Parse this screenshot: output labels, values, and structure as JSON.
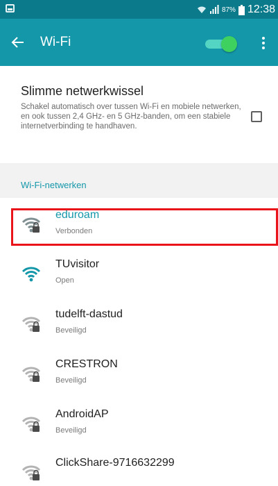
{
  "status_bar": {
    "battery_percent": "87%",
    "time": "12:38",
    "icons": [
      "screenshot-icon",
      "wifi-status-icon",
      "cell-signal-icon",
      "battery-icon"
    ]
  },
  "app_bar": {
    "title": "Wi-Fi",
    "back_icon": "arrow-left-icon",
    "wifi_toggle_on": true,
    "menu_icon": "more-vert-icon"
  },
  "smart_network_switch": {
    "title": "Slimme netwerkwissel",
    "description": "Schakel automatisch over tussen Wi-Fi en mobiele netwerken, en ook tussen 2,4 GHz- en 5 GHz-banden, om een stabiele internetverbinding te handhaven.",
    "checked": false
  },
  "networks_section": {
    "title": "Wi-Fi-netwerken"
  },
  "networks": [
    {
      "name": "eduroam",
      "status": "Verbonden",
      "secured": true,
      "connected": true
    },
    {
      "name": "TUvisitor",
      "status": "Open",
      "secured": false,
      "connected": false
    },
    {
      "name": "tudelft-dastud",
      "status": "Beveiligd",
      "secured": true,
      "connected": false
    },
    {
      "name": "CRESTRON",
      "status": "Beveiligd",
      "secured": true,
      "connected": false
    },
    {
      "name": "AndroidAP",
      "status": "Beveiligd",
      "secured": true,
      "connected": false
    },
    {
      "name": "ClickShare-9716632299",
      "status": "",
      "secured": true,
      "connected": false
    }
  ],
  "colors": {
    "status_bar": "#0b7b8c",
    "app_bar": "#1497a9",
    "accent": "#1497a9",
    "toggle_knob": "#3ed160",
    "highlight": "#e8141a"
  }
}
